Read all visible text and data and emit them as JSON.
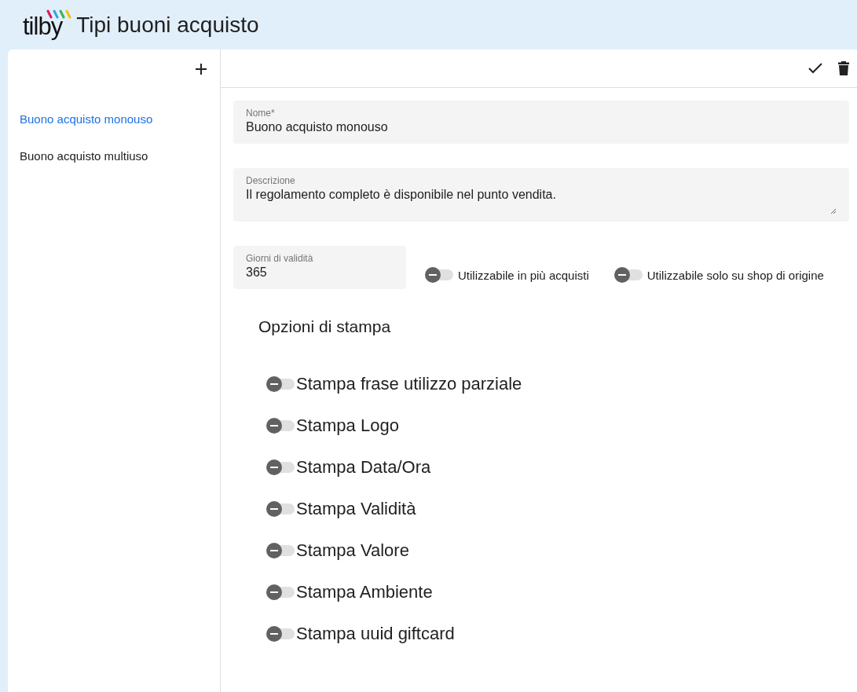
{
  "header": {
    "logo": "tilby",
    "title": "Tipi buoni acquisto"
  },
  "sidebar": {
    "items": [
      {
        "label": "Buono acquisto monouso",
        "selected": true
      },
      {
        "label": "Buono acquisto multiuso",
        "selected": false
      }
    ]
  },
  "form": {
    "name": {
      "label": "Nome*",
      "value": "Buono acquisto monouso"
    },
    "description": {
      "label": "Descrizione",
      "value": "Il regolamento completo è disponibile nel punto vendita."
    },
    "validity": {
      "label": "Giorni di validità",
      "value": "365"
    },
    "toggles": [
      {
        "label": "Utilizzabile in più acquisti",
        "on": false
      },
      {
        "label": "Utilizzabile solo su shop di origine",
        "on": false
      }
    ]
  },
  "print_options": {
    "title": "Opzioni di stampa",
    "items": [
      {
        "label": "Stampa frase utilizzo parziale",
        "on": false
      },
      {
        "label": "Stampa Logo",
        "on": false
      },
      {
        "label": "Stampa Data/Ora",
        "on": false
      },
      {
        "label": "Stampa Validità",
        "on": false
      },
      {
        "label": "Stampa Valore",
        "on": false
      },
      {
        "label": "Stampa Ambiente",
        "on": false
      },
      {
        "label": "Stampa uuid giftcard",
        "on": false
      }
    ]
  }
}
